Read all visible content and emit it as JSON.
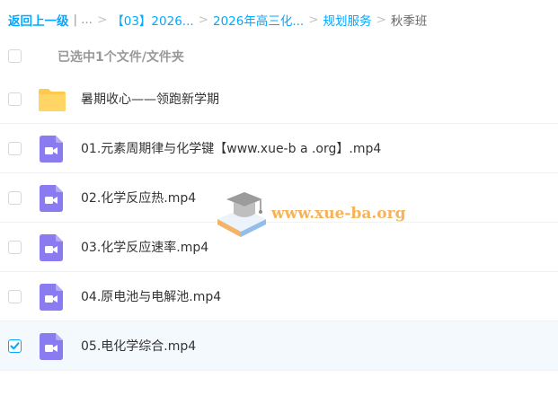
{
  "breadcrumb": {
    "back": "返回上一级",
    "divider": "|",
    "ellipsis": "...",
    "items": [
      {
        "label": "【03】2026..."
      },
      {
        "label": "2026年高三化..."
      },
      {
        "label": "规划服务"
      }
    ],
    "current": "秋季班",
    "separator": ">"
  },
  "selection": {
    "label": "已选中1个文件/文件夹"
  },
  "files": [
    {
      "name": "暑期收心——领跑新学期",
      "type": "folder-icon",
      "checked": false
    },
    {
      "name": "01.元素周期律与化学键【www.xue-b a .org】.mp4",
      "type": "video-file-icon",
      "checked": false
    },
    {
      "name": "02.化学反应热.mp4",
      "type": "video-file-icon",
      "checked": false
    },
    {
      "name": "03.化学反应速率.mp4",
      "type": "video-file-icon",
      "checked": false
    },
    {
      "name": "04.原电池与电解池.mp4",
      "type": "video-file-icon",
      "checked": false
    },
    {
      "name": "05.电化学综合.mp4",
      "type": "video-file-icon",
      "checked": true
    }
  ],
  "watermark": {
    "text": "www.xue-ba.org",
    "icon": "graduation-cap-icon"
  },
  "colors": {
    "accent": "#06a7ff",
    "folder": "#ffc94d",
    "video": "#8b7bf0",
    "selected_row": "#f4f9fe"
  }
}
